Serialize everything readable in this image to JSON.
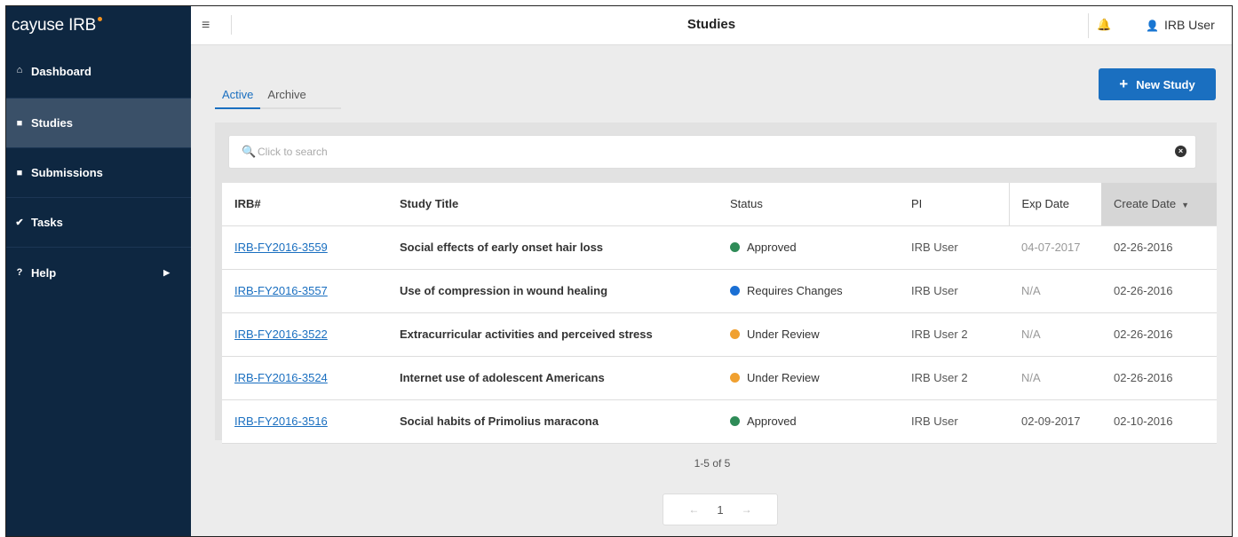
{
  "brand": {
    "name": "cayuse IRB",
    "accent": "#f7931e"
  },
  "sidebar": {
    "items": [
      {
        "label": "Dashboard",
        "icon": "home-icon",
        "glyph": "⌂"
      },
      {
        "label": "Studies",
        "icon": "folder-icon",
        "glyph": "■"
      },
      {
        "label": "Submissions",
        "icon": "file-icon",
        "glyph": "■"
      },
      {
        "label": "Tasks",
        "icon": "check-icon",
        "glyph": "✔"
      },
      {
        "label": "Help",
        "icon": "question-icon",
        "glyph": "?",
        "chevron": "▶"
      }
    ],
    "active": "Studies"
  },
  "header": {
    "title": "Studies",
    "menu_glyph": "≡",
    "bell_glyph": "♫",
    "user_glyph": "☺",
    "user_name": "IRB User"
  },
  "tabs": [
    {
      "label": "Active",
      "active": true
    },
    {
      "label": "Archive",
      "active": false
    }
  ],
  "new_study": {
    "plus": "+",
    "label": "New Study"
  },
  "search": {
    "placeholder": "Click to search",
    "value": ""
  },
  "table": {
    "columns": [
      "IRB#",
      "Study Title",
      "Status",
      "PI",
      "Exp Date",
      "Create Date"
    ],
    "sort_column": "Create Date",
    "rows": [
      {
        "irb": "IRB-FY2016-3559",
        "title": "Social effects of early onset hair loss",
        "status": "Approved",
        "status_color": "#2e8b57",
        "pi": "IRB User",
        "exp": "04-07-2017",
        "created": "02-26-2016"
      },
      {
        "irb": "IRB-FY2016-3557",
        "title": "Use of compression in wound healing",
        "status": "Requires Changes",
        "status_color": "#1a6fd4",
        "pi": "IRB User",
        "exp": "N/A",
        "created": "02-26-2016"
      },
      {
        "irb": "IRB-FY2016-3522",
        "title": "Extracurricular activities and perceived stress",
        "status": "Under Review",
        "status_color": "#f0a030",
        "pi": "IRB User 2",
        "exp": "N/A",
        "created": "02-26-2016"
      },
      {
        "irb": "IRB-FY2016-3524",
        "title": "Internet use of adolescent Americans",
        "status": "Under Review",
        "status_color": "#f0a030",
        "pi": "IRB User 2",
        "exp": "N/A",
        "created": "02-26-2016"
      },
      {
        "irb": "IRB-FY2016-3516",
        "title": "Social habits of Primolius maracona",
        "status": "Approved",
        "status_color": "#2e8b57",
        "pi": "IRB User",
        "exp": "02-09-2017",
        "created": "02-10-2016"
      }
    ]
  },
  "pagination": {
    "summary": "1-5 of 5",
    "current_page": "1",
    "prev_glyph": "←",
    "next_glyph": "→"
  }
}
